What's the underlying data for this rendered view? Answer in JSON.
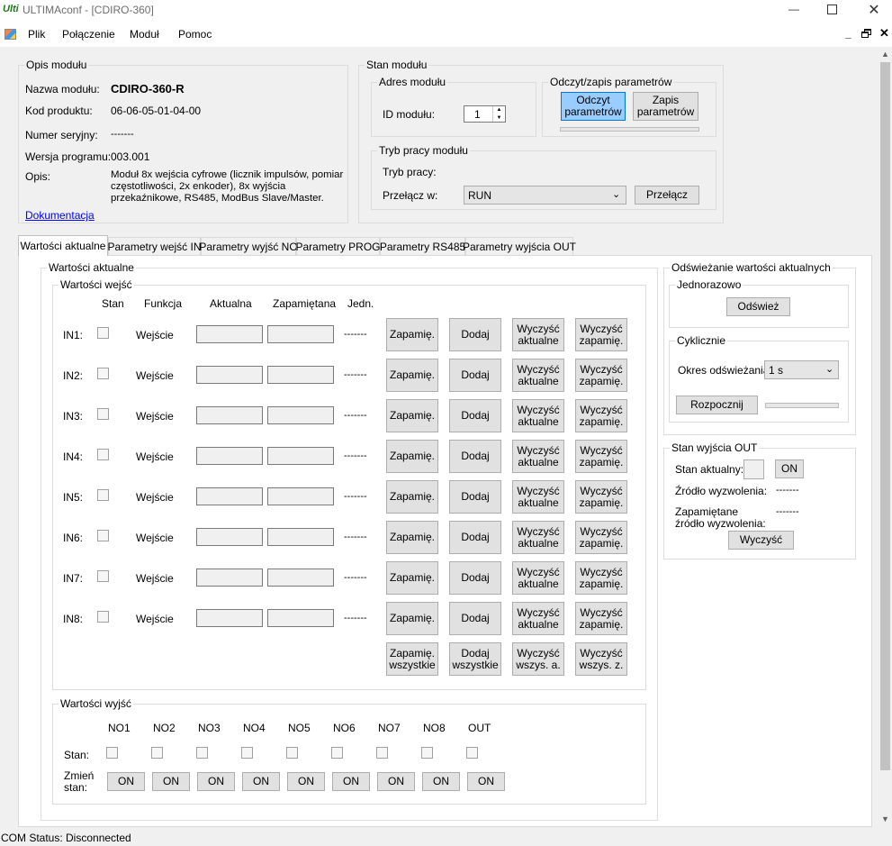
{
  "window": {
    "title": "ULTIMAconf - [CDIRO-360]",
    "logo_text": "Ulti"
  },
  "menu": {
    "items": [
      "Plik",
      "Połączenie",
      "Moduł",
      "Pomoc"
    ]
  },
  "module_info": {
    "group_title": "Opis modułu",
    "name_label": "Nazwa modułu:",
    "name_value": "CDIRO-360-R",
    "product_code_label": "Kod produktu:",
    "product_code_value": "06-06-05-01-04-00",
    "serial_label": "Numer seryjny:",
    "serial_value": "-------",
    "version_label": "Wersja programu:",
    "version_value": "003.001",
    "description_label": "Opis:",
    "description_value": "Moduł 8x wejścia cyfrowe (licznik impulsów, pomiar częstotliwości, 2x enkoder), 8x wyjścia przekaźnikowe, RS485, ModBus Slave/Master.",
    "docs_link": "Dokumentacja"
  },
  "module_state": {
    "group_title": "Stan modułu",
    "address_group": "Adres modułu",
    "id_label": "ID modułu:",
    "id_value": "1",
    "rw_group": "Odczyt/zapis parametrów",
    "read_button": "Odczyt parametrów",
    "write_button": "Zapis parametrów",
    "mode_group": "Tryb pracy modułu",
    "mode_label": "Tryb pracy:",
    "switch_label": "Przełącz w:",
    "switch_value": "RUN",
    "switch_button": "Przełącz"
  },
  "tabs": [
    "Wartości aktualne",
    "Parametry wejść IN",
    "Parametry wyjść NO",
    "Parametry PROG",
    "Parametry RS485",
    "Parametry wyjścia OUT"
  ],
  "current_values": {
    "group_title": "Wartości aktualne",
    "inputs_group": "Wartości wejść",
    "headers": {
      "state": "Stan",
      "function": "Funkcja",
      "current": "Aktualna",
      "stored": "Zapamiętana",
      "unit": "Jedn."
    },
    "rows": [
      {
        "label": "IN1:",
        "function": "Wejście",
        "unit": "-------"
      },
      {
        "label": "IN2:",
        "function": "Wejście",
        "unit": "-------"
      },
      {
        "label": "IN3:",
        "function": "Wejście",
        "unit": "-------"
      },
      {
        "label": "IN4:",
        "function": "Wejście",
        "unit": "-------"
      },
      {
        "label": "IN5:",
        "function": "Wejście",
        "unit": "-------"
      },
      {
        "label": "IN6:",
        "function": "Wejście",
        "unit": "-------"
      },
      {
        "label": "IN7:",
        "function": "Wejście",
        "unit": "-------"
      },
      {
        "label": "IN8:",
        "function": "Wejście",
        "unit": "-------"
      }
    ],
    "row_buttons": {
      "store": "Zapamię.",
      "add": "Dodaj",
      "clear_current": "Wyczyść aktualne",
      "clear_stored": "Wyczyść zapamię."
    },
    "all_buttons": {
      "store_all": "Zapamię. wszystkie",
      "add_all": "Dodaj wszystkie",
      "clear_all_current": "Wyczyść wszys. a.",
      "clear_all_stored": "Wyczyść wszys. z."
    }
  },
  "outputs": {
    "group_title": "Wartości wyjść",
    "columns": [
      "NO1",
      "NO2",
      "NO3",
      "NO4",
      "NO5",
      "NO6",
      "NO7",
      "NO8",
      "OUT"
    ],
    "state_label": "Stan:",
    "change_label": "Zmień stan:",
    "on_label": "ON"
  },
  "refresh": {
    "group_title": "Odświeżanie wartości aktualnych",
    "once_group": "Jednorazowo",
    "refresh_button": "Odśwież",
    "cyclic_group": "Cyklicznie",
    "period_label": "Okres odświeżania:",
    "period_value": "1 s",
    "start_button": "Rozpocznij"
  },
  "out_state": {
    "group_title": "Stan wyjścia OUT",
    "current_label": "Stan aktualny:",
    "on_button": "ON",
    "source_label": "Źródło wyzwolenia:",
    "source_value": "-------",
    "stored_source_label": "Zapamiętane źródło wyzwolenia:",
    "stored_source_value": "-------",
    "clear_button": "Wyczyść"
  },
  "status_bar": {
    "text": "COM Status: Disconnected"
  },
  "colors": {
    "window_bg": "#f0f0f0",
    "highlight_button": "#99ccff",
    "highlight_border": "#0078d7",
    "link": "#0000ff"
  }
}
